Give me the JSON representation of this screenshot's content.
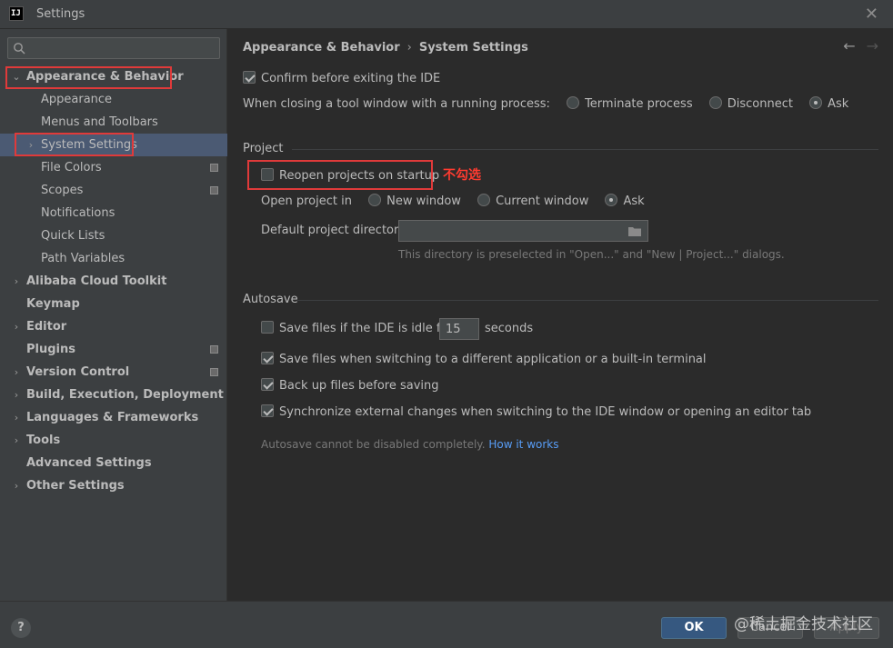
{
  "window": {
    "app_icon": "IJ",
    "title": "Settings"
  },
  "sidebar": {
    "search_placeholder": "",
    "items": [
      {
        "label": "Appearance & Behavior",
        "arrow": "expanded"
      },
      {
        "label": "Appearance"
      },
      {
        "label": "Menus and Toolbars"
      },
      {
        "label": "System Settings",
        "arrow": "collapsed"
      },
      {
        "label": "File Colors"
      },
      {
        "label": "Scopes"
      },
      {
        "label": "Notifications"
      },
      {
        "label": "Quick Lists"
      },
      {
        "label": "Path Variables"
      },
      {
        "label": "Alibaba Cloud Toolkit",
        "arrow": "collapsed"
      },
      {
        "label": "Keymap"
      },
      {
        "label": "Editor",
        "arrow": "collapsed"
      },
      {
        "label": "Plugins"
      },
      {
        "label": "Version Control",
        "arrow": "collapsed"
      },
      {
        "label": "Build, Execution, Deployment",
        "arrow": "collapsed"
      },
      {
        "label": "Languages & Frameworks",
        "arrow": "collapsed"
      },
      {
        "label": "Tools",
        "arrow": "collapsed"
      },
      {
        "label": "Advanced Settings"
      },
      {
        "label": "Other Settings",
        "arrow": "collapsed"
      }
    ]
  },
  "breadcrumb": {
    "parent": "Appearance & Behavior",
    "separator": "›",
    "current": "System Settings",
    "back_icon": "←",
    "forward_icon": "→"
  },
  "general": {
    "confirm_exit_label": "Confirm before exiting the IDE",
    "confirm_exit_checked": true,
    "closing_label": "When closing a tool window with a running process:",
    "closing_options": [
      "Terminate process",
      "Disconnect",
      "Ask"
    ],
    "closing_selected": "Ask"
  },
  "project": {
    "section_title": "Project",
    "reopen_label": "Reopen projects on startup",
    "reopen_checked": false,
    "annotation": "不勾选",
    "open_in_label": "Open project in",
    "open_in_options": [
      "New window",
      "Current window",
      "Ask"
    ],
    "open_in_selected": "Ask",
    "default_dir_label": "Default project directory:",
    "default_dir_value": "",
    "default_dir_hint": "This directory is preselected in \"Open...\" and \"New | Project...\" dialogs."
  },
  "autosave": {
    "section_title": "Autosave",
    "idle_label": "Save files if the IDE is idle for",
    "idle_checked": false,
    "idle_value": "15",
    "idle_unit": "seconds",
    "switch_label": "Save files when switching to a different application or a built-in terminal",
    "switch_checked": true,
    "backup_label": "Back up files before saving",
    "backup_checked": true,
    "sync_label": "Synchronize external changes when switching to the IDE window or opening an editor tab",
    "sync_checked": true,
    "note": "Autosave cannot be disabled completely.",
    "note_link": "How it works"
  },
  "footer": {
    "help": "?",
    "ok": "OK",
    "cancel": "Cancel",
    "apply": "Apply",
    "watermark": "@稀土掘金技术社区"
  }
}
